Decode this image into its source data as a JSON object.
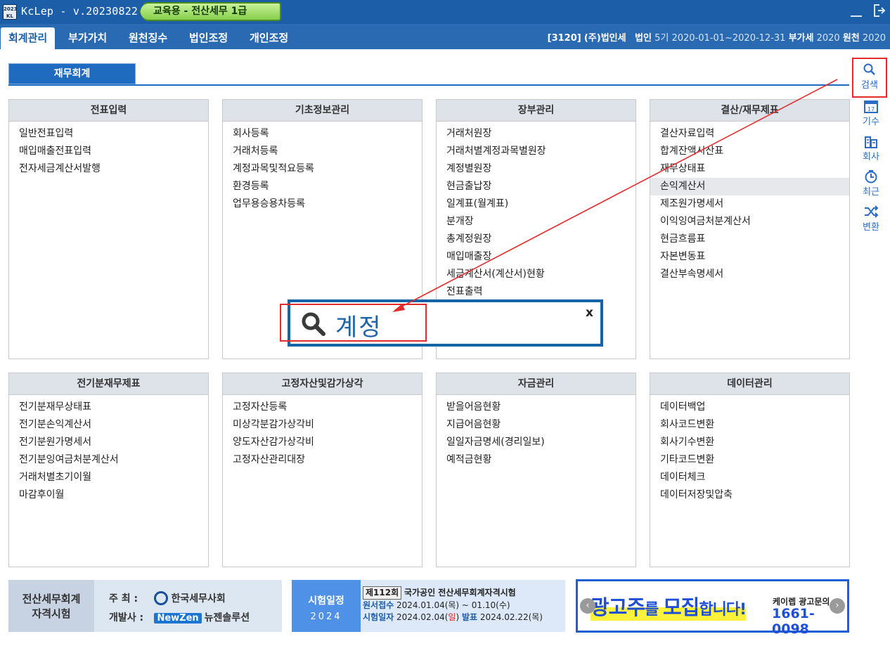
{
  "titlebar": {
    "app_icon_text_top": "2023",
    "app_icon_text_bottom": "KL",
    "title": "KcLep - v.20230822",
    "edition": "교육용 - 전산세무 1급"
  },
  "menu": {
    "tabs": [
      "회계관리",
      "부가가치",
      "원천징수",
      "법인조정",
      "개인조정"
    ],
    "active_tab": "회계관리"
  },
  "company": {
    "code": "[3120]",
    "name": "(주)법인세",
    "type_label": "법인",
    "period_no": "5기",
    "period": "2020-01-01~2020-12-31",
    "vat_label": "부가세",
    "vat_year": "2020",
    "withholding_label": "원천",
    "withholding_year": "2020"
  },
  "section_tab": "재무회계",
  "right_toolbar": {
    "search": "검색",
    "period": "기수",
    "company": "회사",
    "recent": "최근",
    "convert": "변환"
  },
  "panels": [
    {
      "title": "전표입력",
      "items": [
        "일반전표입력",
        "매입매출전표입력",
        "전자세금계산서발행"
      ]
    },
    {
      "title": "기초정보관리",
      "items": [
        "회사등록",
        "거래처등록",
        "계정과목및적요등록",
        "환경등록",
        "업무용승용차등록"
      ]
    },
    {
      "title": "장부관리",
      "items": [
        "거래처원장",
        "거래처별계정과목별원장",
        "계정별원장",
        "현금출납장",
        "일계표(월계표)",
        "분개장",
        "총계정원장",
        "매입매출장",
        "세금계산서(계산서)현황",
        "전표출력"
      ]
    },
    {
      "title": "결산/재무제표",
      "items": [
        "결산자료입력",
        "합계잔액시산표",
        "재무상태표",
        "손익계산서",
        "제조원가명세서",
        "이익잉여금처분계산서",
        "현금흐름표",
        "자본변동표",
        "결산부속명세서"
      ],
      "highlighted": "손익계산서"
    },
    {
      "title": "전기분재무제표",
      "items": [
        "전기분재무상태표",
        "전기분손익계산서",
        "전기분원가명세서",
        "전기분잉여금처분계산서",
        "거래처별초기이월",
        "마감후이월"
      ]
    },
    {
      "title": "고정자산및감가상각",
      "items": [
        "고정자산등록",
        "미상각분감가상각비",
        "양도자산감가상각비",
        "고정자산관리대장"
      ]
    },
    {
      "title": "자금관리",
      "items": [
        "받을어음현황",
        "지급어음현황",
        "일일자금명세(경리일보)",
        "예적금현황"
      ]
    },
    {
      "title": "데이터관리",
      "items": [
        "데이터백업",
        "회사코드변환",
        "회사기수변환",
        "기타코드변환",
        "데이터체크",
        "데이터저장및압축"
      ]
    }
  ],
  "search_popup": {
    "query": "계정",
    "close": "x"
  },
  "banner_exam": {
    "left_line1": "전산세무회계",
    "left_line2": "자격시험",
    "host_label": "주  최 :",
    "host": "한국세무사회",
    "dev_label": "개발사 :",
    "dev_badge": "NewZen",
    "dev_name": "뉴젠솔루션"
  },
  "banner_schedule": {
    "left_title": "시험일정",
    "left_year": "2024",
    "exam_no": "제112회",
    "exam_title": "국가공인 전산세무회계자격시험",
    "apply_label": "원서접수",
    "apply_dates": "2024.01.04(목) ~ 01.10(수)",
    "exam_label": "시험일자",
    "exam_date_prefix": "2024.02.04(",
    "exam_date_day": "일",
    "exam_date_suffix": ")",
    "result_label": "발표",
    "result_date": "2024.02.22(목)"
  },
  "banner_ad": {
    "main_1": "광고주",
    "main_2": "를 ",
    "main_3": "모집",
    "main_4": "합니다!",
    "sub": "케이렙 광고문의",
    "phone": "1661-0098",
    "prev": "‹",
    "next": "›"
  },
  "colors": {
    "titlebar": "#1c5fa8",
    "menubar": "#2a6ab3",
    "section_tab": "#1f6bc0",
    "panel_header": "#dee3ea",
    "highlight_red": "#e52c2c",
    "popup_border": "#1464a8"
  }
}
